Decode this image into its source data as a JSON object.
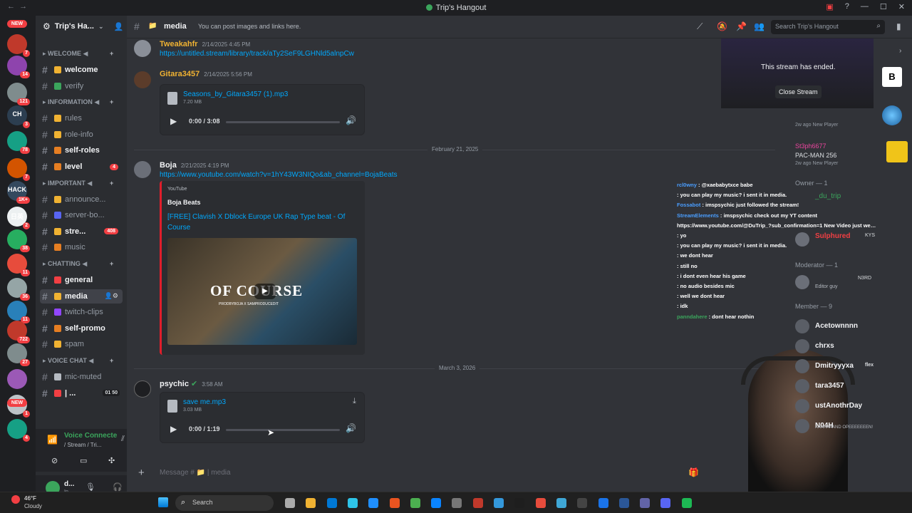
{
  "window": {
    "title": "Trip's Hangout",
    "back": "←",
    "forward": "→"
  },
  "server_list": [
    {
      "label": "NEW",
      "badge": ""
    },
    {
      "label": "",
      "badge": "7"
    },
    {
      "label": "",
      "badge": "14"
    },
    {
      "label": "",
      "badge": "121"
    },
    {
      "label": "CH",
      "badge": "3"
    },
    {
      "label": "",
      "badge": "78"
    },
    {
      "label": "",
      "badge": "7"
    },
    {
      "label": "HACK",
      "badge": "1K+"
    },
    {
      "label": "日英",
      "badge": "2"
    },
    {
      "label": "",
      "badge": "38"
    },
    {
      "label": "",
      "badge": "11"
    },
    {
      "label": "",
      "badge": "36"
    },
    {
      "label": "",
      "badge": "11"
    },
    {
      "label": "",
      "badge": "722"
    },
    {
      "label": "",
      "badge": "27"
    },
    {
      "label": "",
      "badge": ""
    },
    {
      "label": "",
      "badge": "1"
    },
    {
      "label": "",
      "badge": "4"
    },
    {
      "label": "NEW",
      "badge": ""
    }
  ],
  "guild": {
    "name": "Trip's Ha...",
    "categories": [
      {
        "name": "WELCOME ◀",
        "channels": [
          {
            "name": "welcome",
            "emoji_color": "#f0b232",
            "bright": true,
            "count": ""
          },
          {
            "name": "verify",
            "emoji_color": "#3ba55c",
            "bright": false,
            "count": ""
          }
        ]
      },
      {
        "name": "INFORMATION ◀",
        "channels": [
          {
            "name": "rules",
            "emoji_color": "#f0b232",
            "bright": false,
            "count": ""
          },
          {
            "name": "role-info",
            "emoji_color": "#f0b232",
            "bright": false,
            "count": ""
          },
          {
            "name": "self-roles",
            "emoji_color": "#e67e22",
            "bright": true,
            "count": ""
          },
          {
            "name": "level",
            "emoji_color": "#e67e22",
            "bright": true,
            "count": "4"
          }
        ]
      },
      {
        "name": "IMPORTANT ◀",
        "channels": [
          {
            "name": "announce...",
            "emoji_color": "#f0b232",
            "bright": false,
            "count": ""
          },
          {
            "name": "server-bo...",
            "emoji_color": "#5865f2",
            "bright": false,
            "count": ""
          },
          {
            "name": "stre...",
            "emoji_color": "#f0b232",
            "bright": true,
            "count": "408"
          },
          {
            "name": "music",
            "emoji_color": "#e67e22",
            "bright": false,
            "count": ""
          }
        ]
      },
      {
        "name": "CHATTING ◀",
        "channels": [
          {
            "name": "general",
            "emoji_color": "#f23f43",
            "bright": true,
            "count": ""
          },
          {
            "name": "media",
            "emoji_color": "#f0b232",
            "bright": true,
            "count": ""
          },
          {
            "name": "twitch-clips",
            "emoji_color": "#9146ff",
            "bright": false,
            "count": ""
          },
          {
            "name": "self-promo",
            "emoji_color": "#e67e22",
            "bright": true,
            "count": ""
          },
          {
            "name": "spam",
            "emoji_color": "#f0b232",
            "bright": false,
            "count": ""
          }
        ]
      },
      {
        "name": "VOICE CHAT ◀",
        "channels": [
          {
            "name": "mic-muted",
            "emoji_color": "#b5bac1",
            "bright": false,
            "count": ""
          },
          {
            "name": "| ...",
            "emoji_color": "#f23f43",
            "bright": true,
            "count": ""
          }
        ]
      }
    ],
    "voice_user_counts": "01  50",
    "voice_connected": "Voice Connecte",
    "voice_sub": "/ Stream / Tri...",
    "user_name": "d...",
    "user_status": "In"
  },
  "header": {
    "channel": "media",
    "topic": "You can post images and links here.",
    "search_placeholder": "Search Trip's Hangout"
  },
  "messages": [
    {
      "user": "Tweakahfr",
      "color": "#f0b232",
      "time": "2/14/2025 4:45 PM",
      "link": "https://untitled.stream/library/track/aTy2SeF9LGHNld5alnpCw"
    },
    {
      "user": "Gitara3457",
      "color": "#f0b232",
      "time": "2/14/2025 5:56 PM",
      "file": "Seasons_by_Gitara3457 (1).mp3",
      "size": "7.20 MB",
      "duration": "0:00 / 3:08",
      "progress": 0
    },
    {
      "date_divider": "February 21, 2025"
    },
    {
      "user": "Boja",
      "color": "#f2f3f5",
      "time": "2/21/2025 4:19 PM",
      "link": "https://www.youtube.com/watch?v=1hY43W3NIQo&ab_channel=BojaBeats",
      "embed": {
        "provider": "YouTube",
        "author": "Boja Beats",
        "title": "[FREE] Clavish X Dblock Europe UK Rap Type beat - Of Course",
        "thumb_text": "OF COURSE",
        "thumb_sub": "PRODBYBOJA X SAMPRODUCEDIT"
      }
    },
    {
      "date_divider": "March 3, 2026"
    },
    {
      "user": "psychic",
      "color": "#f2f3f5",
      "time": "3:58 AM",
      "file": "save me.mp3",
      "size": "3.03 MB",
      "duration": "0:00 / 1:19",
      "progress": 0
    }
  ],
  "composer": {
    "placeholder": "Message # 📁 | media"
  },
  "stream": {
    "ended": "This stream has ended.",
    "close": "Close Stream"
  },
  "overlay_chat": [
    {
      "user": "rcl0wny",
      "text": ": @xaebabytxce babe",
      "color": "#4a9eff"
    },
    {
      "user": "",
      "text": ": you can play my music? i sent it in media.",
      "color": "#4a9eff"
    },
    {
      "user": "Fossabot",
      "text": ": imspsychic just followed the stream!",
      "color": "#4a9eff"
    },
    {
      "user": "StreamElements",
      "text": ": imspsychic check out my YT content",
      "color": "#4a9eff"
    },
    {
      "user": "",
      "text": "https://www.youtube.com/@DuTrip_?sub_confirmation=1 New Video just went live!",
      "color": "#fff"
    },
    {
      "user": "",
      "text": ": yo",
      "color": "#4a9eff"
    },
    {
      "user": "",
      "text": ": you can play my music? i sent it in media.",
      "color": "#4a9eff"
    },
    {
      "user": "",
      "text": ": we dont hear",
      "color": "#4a9eff"
    },
    {
      "user": "",
      "text": ": still no",
      "color": "#4a9eff"
    },
    {
      "user": "",
      "text": ": i dont even hear his game",
      "color": "#4a9eff"
    },
    {
      "user": "",
      "text": ": no audio besides mic",
      "color": "#4a9eff"
    },
    {
      "user": "",
      "text": ": well we dont hear",
      "color": "#4a9eff"
    },
    {
      "user": "",
      "text": ": idk",
      "color": "#4a9eff"
    },
    {
      "user": "panndahere",
      "text": ": dont hear nothin",
      "color": "#3ba55c"
    }
  ],
  "members": {
    "top_items": [
      {
        "name": "",
        "sub": "2w ago  New Player"
      },
      {
        "name": "St3ph6677",
        "sub": "PAC-MAN 256",
        "sub2": "2w ago  New Player",
        "color": "#eb459e"
      }
    ],
    "owner_header": "Owner — 1",
    "owner": {
      "name": "_du_trip",
      "sub": "voice"
    },
    "sulphured": {
      "name": "Sulphured",
      "tag": "KYS",
      "color": "#f23f43"
    },
    "moderator_header": "Moderator — 1",
    "moderator": {
      "name": "",
      "tag": "N3RD",
      "sub": "Editor guy"
    },
    "member_header": "Member — 9",
    "list": [
      {
        "name": "Acetownnnn",
        "tag": ""
      },
      {
        "name": "chrxs",
        "tag": ""
      },
      {
        "name": "Dmitryyyxa",
        "tag": "flex"
      },
      {
        "name": "tara3457",
        "tag": ""
      },
      {
        "name": "ustAnothrDay",
        "tag": ""
      },
      {
        "name": "N04H",
        "tag": ""
      }
    ],
    "last_sub": "AAAAAAAND OPEEEEEEEN!"
  },
  "taskbar": {
    "weather_temp": "46°F",
    "weather_desc": "Cloudy",
    "search": "Search"
  }
}
